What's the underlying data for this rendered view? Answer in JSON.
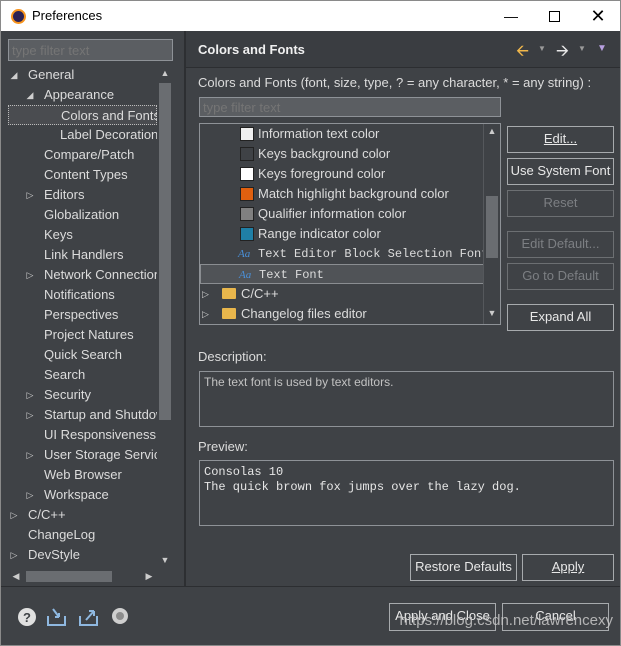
{
  "window": {
    "title": "Preferences"
  },
  "left": {
    "filter_placeholder": "type filter text",
    "tree": [
      {
        "label": "General",
        "depth": 0,
        "arrow": "down"
      },
      {
        "label": "Appearance",
        "depth": 1,
        "arrow": "down"
      },
      {
        "label": "Colors and Fonts",
        "depth": 2,
        "arrow": "",
        "selected": true
      },
      {
        "label": "Label Decorations",
        "depth": 2,
        "arrow": ""
      },
      {
        "label": "Compare/Patch",
        "depth": 1,
        "arrow": ""
      },
      {
        "label": "Content Types",
        "depth": 1,
        "arrow": ""
      },
      {
        "label": "Editors",
        "depth": 1,
        "arrow": "right"
      },
      {
        "label": "Globalization",
        "depth": 1,
        "arrow": ""
      },
      {
        "label": "Keys",
        "depth": 1,
        "arrow": ""
      },
      {
        "label": "Link Handlers",
        "depth": 1,
        "arrow": ""
      },
      {
        "label": "Network Connections",
        "depth": 1,
        "arrow": "right"
      },
      {
        "label": "Notifications",
        "depth": 1,
        "arrow": ""
      },
      {
        "label": "Perspectives",
        "depth": 1,
        "arrow": ""
      },
      {
        "label": "Project Natures",
        "depth": 1,
        "arrow": ""
      },
      {
        "label": "Quick Search",
        "depth": 1,
        "arrow": ""
      },
      {
        "label": "Search",
        "depth": 1,
        "arrow": ""
      },
      {
        "label": "Security",
        "depth": 1,
        "arrow": "right"
      },
      {
        "label": "Startup and Shutdown",
        "depth": 1,
        "arrow": "right"
      },
      {
        "label": "UI Responsiveness",
        "depth": 1,
        "arrow": ""
      },
      {
        "label": "User Storage Service",
        "depth": 1,
        "arrow": "right"
      },
      {
        "label": "Web Browser",
        "depth": 1,
        "arrow": ""
      },
      {
        "label": "Workspace",
        "depth": 1,
        "arrow": "right"
      },
      {
        "label": "C/C++",
        "depth": 0,
        "arrow": "right"
      },
      {
        "label": "ChangeLog",
        "depth": 0,
        "arrow": ""
      },
      {
        "label": "DevStyle",
        "depth": 0,
        "arrow": "right"
      }
    ]
  },
  "right": {
    "header_title": "Colors and Fonts",
    "intro": "Colors and Fonts (font, size, type, ? = any character, * = any string) :",
    "filter_placeholder": "type filter text",
    "font_items": [
      {
        "label": "Information text color",
        "kind": "color",
        "color": "#f0f0f0"
      },
      {
        "label": "Keys background color",
        "kind": "color",
        "color": "#3f4246"
      },
      {
        "label": "Keys foreground color",
        "kind": "color",
        "color": "#ffffff"
      },
      {
        "label": "Match highlight background color",
        "kind": "color",
        "color": "#e0600f"
      },
      {
        "label": "Qualifier information color",
        "kind": "color",
        "color": "#808080"
      },
      {
        "label": "Range indicator color",
        "kind": "color",
        "color": "#1f7fa6"
      },
      {
        "label": "Text Editor Block Selection Font",
        "kind": "font"
      },
      {
        "label": "Text Font",
        "kind": "font",
        "selected": true
      },
      {
        "label": "C/C++",
        "kind": "folder"
      },
      {
        "label": "Changelog files editor",
        "kind": "folder"
      }
    ],
    "buttons": {
      "edit": "Edit...",
      "use_system_font": "Use System Font",
      "reset": "Reset",
      "edit_default": "Edit Default...",
      "go_to_default": "Go to Default",
      "expand_all": "Expand All"
    },
    "description_label": "Description:",
    "description_text": "The text font is used by text editors.",
    "preview_label": "Preview:",
    "preview_lines": [
      "Consolas 10",
      "The quick brown fox jumps over the lazy dog."
    ],
    "restore_defaults": "Restore Defaults",
    "apply": "Apply"
  },
  "bottom": {
    "apply_and_close": "Apply and Close",
    "cancel": "Cancel",
    "watermark": "https://blog.csdn.net/lawrencexy"
  }
}
